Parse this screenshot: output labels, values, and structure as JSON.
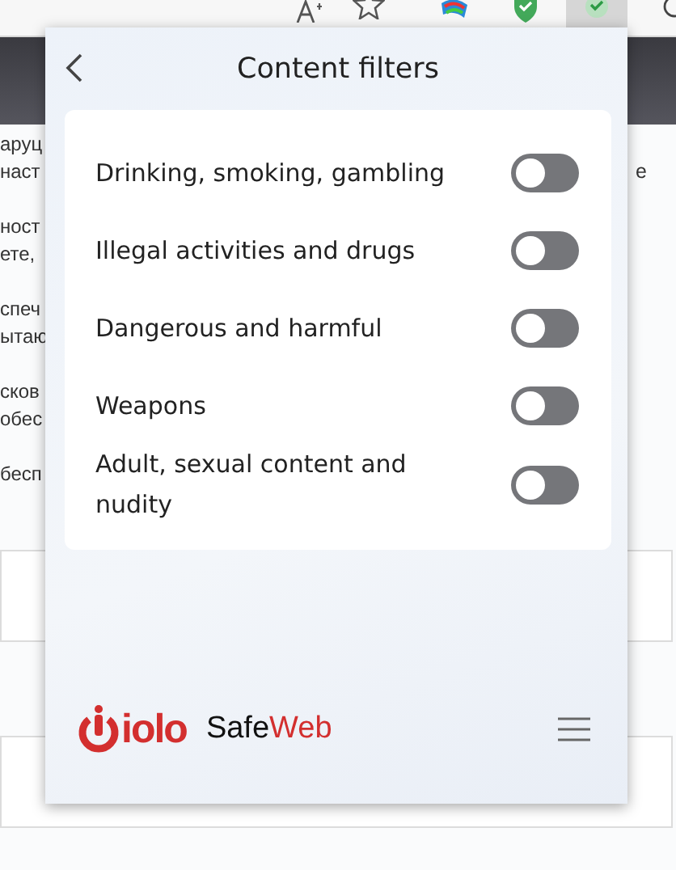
{
  "page_text_fragments": [
    {
      "left": [
        "аруц",
        "наст"
      ],
      "right": "е"
    },
    {
      "left": [
        "ност",
        "ете,"
      ]
    },
    {
      "left": [
        "спеч",
        "ытаю"
      ]
    },
    {
      "left": [
        "сков",
        "обес"
      ]
    },
    {
      "left": [
        "бесп"
      ]
    }
  ],
  "popup": {
    "title": "Content filters",
    "filters": [
      {
        "label": "Drinking, smoking, gambling",
        "on": false
      },
      {
        "label": "Illegal activities and drugs",
        "on": false
      },
      {
        "label": "Dangerous and harmful",
        "on": false
      },
      {
        "label": "Weapons",
        "on": false
      },
      {
        "label": "Adult, sexual content and nudity",
        "on": false
      }
    ],
    "footer": {
      "logo": "iolo",
      "product": [
        "Safe",
        "Web"
      ]
    }
  }
}
